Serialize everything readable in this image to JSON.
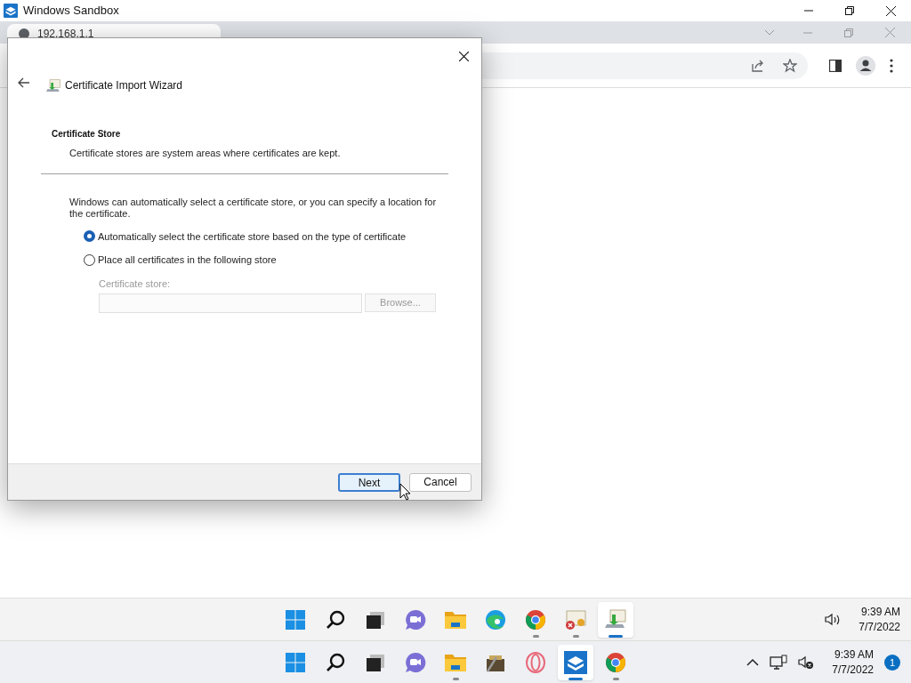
{
  "sandbox_window": {
    "title": "Windows Sandbox"
  },
  "browser": {
    "tab": {
      "title": "192.168.1.1"
    }
  },
  "dialog": {
    "title": "Certificate Import Wizard",
    "heading": "Certificate Store",
    "subheading": "Certificate stores are system areas where certificates are kept.",
    "intro": "Windows can automatically select a certificate store, or you can specify a location for the certificate.",
    "options": [
      {
        "label": "Automatically select the certificate store based on the type of certificate",
        "selected": true
      },
      {
        "label": "Place all certificates in the following store",
        "selected": false
      }
    ],
    "store": {
      "label": "Certificate store:",
      "browse": "Browse...",
      "disabled": true
    },
    "buttons": [
      {
        "label": "Next",
        "default": true
      },
      {
        "label": "Cancel",
        "default": false
      }
    ]
  },
  "inner_taskbar": {
    "items": [
      {
        "kind": "start",
        "running": false,
        "active": false
      },
      {
        "kind": "search",
        "running": false,
        "active": false
      },
      {
        "kind": "taskview",
        "running": false,
        "active": false
      },
      {
        "kind": "chat",
        "running": false,
        "active": false
      },
      {
        "kind": "folder",
        "running": false,
        "active": false
      },
      {
        "kind": "edge",
        "running": false,
        "active": false
      },
      {
        "kind": "chrome",
        "running": true,
        "active": false
      },
      {
        "kind": "certerror",
        "running": true,
        "active": false
      },
      {
        "kind": "certimport",
        "running": true,
        "active": true
      }
    ],
    "time": "9:39 AM",
    "date": "7/7/2022"
  },
  "outer_taskbar": {
    "items": [
      {
        "kind": "start",
        "running": false,
        "active": false
      },
      {
        "kind": "search",
        "running": false,
        "active": false
      },
      {
        "kind": "taskview",
        "running": false,
        "active": false
      },
      {
        "kind": "chat",
        "running": false,
        "active": false
      },
      {
        "kind": "folder",
        "running": true,
        "active": false
      },
      {
        "kind": "toolbox",
        "running": false,
        "active": false
      },
      {
        "kind": "opera",
        "running": false,
        "active": false
      },
      {
        "kind": "sandbox",
        "running": true,
        "active": true
      },
      {
        "kind": "chrome",
        "running": true,
        "active": false
      }
    ],
    "time": "9:39 AM",
    "date": "7/7/2022",
    "badge": "1"
  }
}
